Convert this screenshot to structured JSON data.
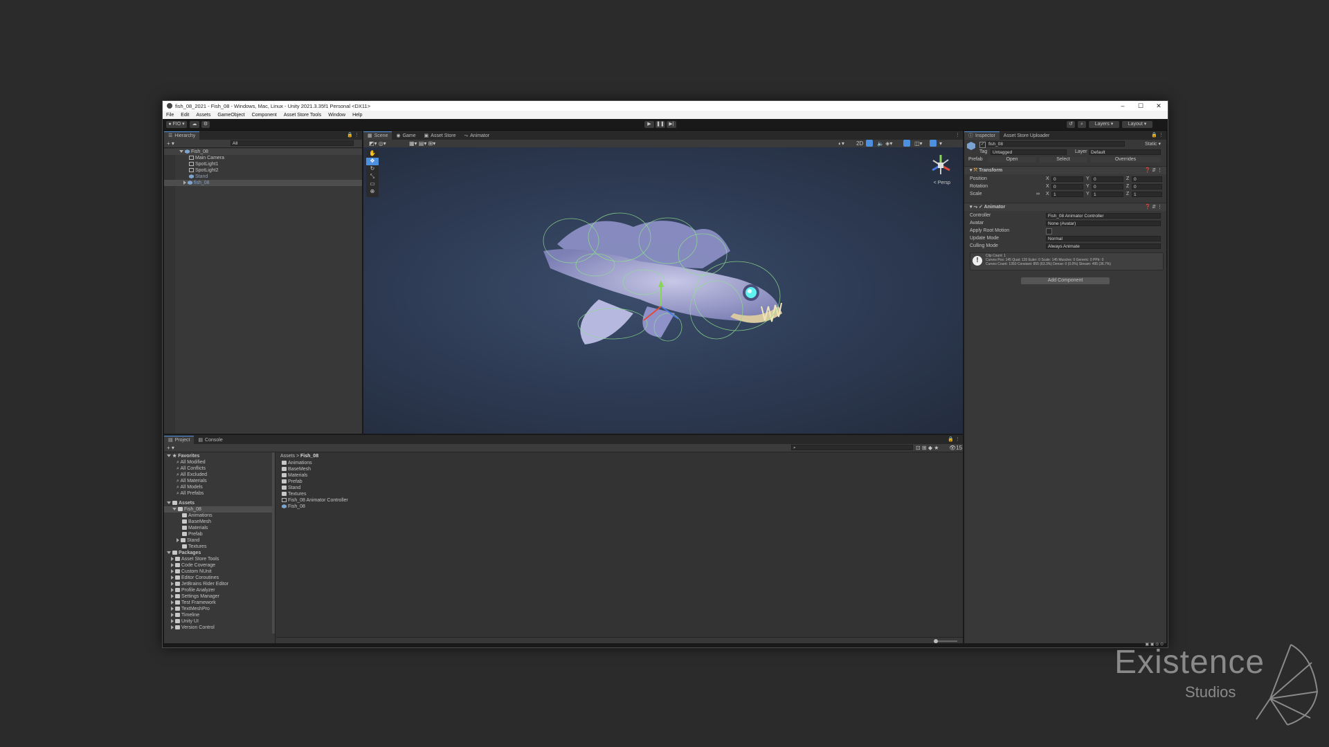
{
  "window": {
    "title": "fish_08_2021 - Fish_08 - Windows, Mac, Linux - Unity 2021.3.35f1 Personal <DX11>",
    "controls": [
      "–",
      "☐",
      "✕"
    ]
  },
  "menu": [
    "File",
    "Edit",
    "Assets",
    "GameObject",
    "Component",
    "Asset Store Tools",
    "Window",
    "Help"
  ],
  "toolbar": {
    "account": "FIO",
    "layers": "Layers",
    "layout": "Layout"
  },
  "hierarchy": {
    "tab": "Hierarchy",
    "search_placeholder": "All",
    "items": [
      {
        "label": "Fish_08",
        "icon": "unity-scene-icon"
      },
      {
        "label": "Main Camera",
        "icon": "camera-icon"
      },
      {
        "label": "SpotLight1",
        "icon": "light-icon"
      },
      {
        "label": "SpotLight2",
        "icon": "light-icon"
      },
      {
        "label": "Stand",
        "icon": "cube-icon"
      },
      {
        "label": "fish_08",
        "icon": "prefab-icon"
      }
    ]
  },
  "scene": {
    "tabs": [
      "Scene",
      "Game",
      "Asset Store",
      "Animator"
    ],
    "mode_2d": "2D",
    "persp": "< Persp",
    "gizmo_count": "15"
  },
  "inspector": {
    "tabs": [
      "Inspector",
      "Asset Store Uploader"
    ],
    "object_name": "fish_08",
    "static": "Static",
    "tag_label": "Tag",
    "tag_value": "Untagged",
    "layer_label": "Layer",
    "layer_value": "Default",
    "prefab_label": "Prefab",
    "prefab_buttons": [
      "Open",
      "Select",
      "Overrides"
    ],
    "transform": {
      "title": "Transform",
      "rows": [
        {
          "label": "Position",
          "x": "0",
          "y": "0",
          "z": "0"
        },
        {
          "label": "Rotation",
          "x": "0",
          "y": "0",
          "z": "0"
        },
        {
          "label": "Scale",
          "x": "1",
          "y": "1",
          "z": "1"
        }
      ]
    },
    "animator": {
      "title": "Animator",
      "controller_label": "Controller",
      "controller_value": "Fish_08 Animator Controller",
      "avatar_label": "Avatar",
      "avatar_value": "None (Avatar)",
      "apply_root_label": "Apply Root Motion",
      "update_label": "Update Mode",
      "update_value": "Normal",
      "culling_label": "Culling Mode",
      "culling_value": "Always Animate",
      "info_line1": "Clip Count: 1",
      "info_line2": "Curves Pos: 145 Quat: 120 Euler: 0 Scale: 145 Muscles: 0 Generic: 0 PPtr: 0",
      "info_line3": "Curves Count: 1350 Constant: 855 (63.3%) Dense: 0 (0.0%) Stream: 495 (36.7%)"
    },
    "add_component": "Add Component"
  },
  "project": {
    "tabs": [
      "Project",
      "Console"
    ],
    "favorites_title": "Favorites",
    "favorites": [
      "All Modified",
      "All Conflicts",
      "All Excluded",
      "All Materials",
      "All Models",
      "All Prefabs"
    ],
    "assets_title": "Assets",
    "assets_tree": [
      "Fish_08",
      "Animations",
      "BaseMesh",
      "Materials",
      "Prefab",
      "Stand",
      "Textures"
    ],
    "packages_title": "Packages",
    "packages": [
      "Asset Store Tools",
      "Code Coverage",
      "Custom NUnit",
      "Editor Coroutines",
      "JetBrains Rider Editor",
      "Profile Analyzer",
      "Settings Manager",
      "Test Framework",
      "TextMeshPro",
      "Timeline",
      "Unity UI",
      "Version Control"
    ],
    "breadcrumb_root": "Assets",
    "breadcrumb_sep": ">",
    "breadcrumb_current": "Fish_08",
    "files": [
      {
        "label": "Animations",
        "icon": "folder-icon"
      },
      {
        "label": "BaseMesh",
        "icon": "folder-icon"
      },
      {
        "label": "Materials",
        "icon": "folder-icon"
      },
      {
        "label": "Prefab",
        "icon": "folder-icon"
      },
      {
        "label": "Stand",
        "icon": "folder-icon"
      },
      {
        "label": "Textures",
        "icon": "folder-icon"
      },
      {
        "label": "Fish_08 Animator Controller",
        "icon": "animator-controller-icon"
      },
      {
        "label": "Fish_08",
        "icon": "unity-scene-icon"
      }
    ],
    "count": "15"
  },
  "watermark": {
    "title": "Existence",
    "subtitle": "Studios"
  },
  "colors": {
    "accent": "#4d90e0",
    "panel": "#383838",
    "scene_bg": "#2f3c55"
  }
}
